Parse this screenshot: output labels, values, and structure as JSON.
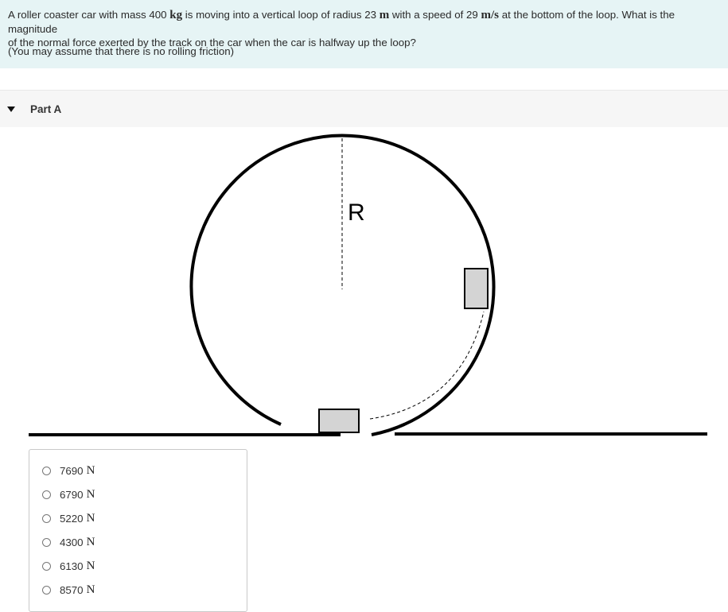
{
  "problem": {
    "line1_a": "A roller coaster car with mass 400 ",
    "line1_kg": "kg",
    "line1_b": " is moving into a vertical loop of radius 23 ",
    "line1_m": "m",
    "line1_c": " with a speed of 29 ",
    "line1_ms": "m/s",
    "line1_d": " at the bottom of the loop. What is the magnitude",
    "line2": "of the normal force exerted by the track on the car when the car is halfway up the loop?",
    "note": "(You may assume that there is no rolling friction)"
  },
  "part": {
    "label": "Part A"
  },
  "diagram": {
    "radius_label": "R"
  },
  "choices": [
    {
      "value": "7690",
      "unit": "N"
    },
    {
      "value": "6790",
      "unit": "N"
    },
    {
      "value": "5220",
      "unit": "N"
    },
    {
      "value": "4300",
      "unit": "N"
    },
    {
      "value": "6130",
      "unit": "N"
    },
    {
      "value": "8570",
      "unit": "N"
    }
  ]
}
